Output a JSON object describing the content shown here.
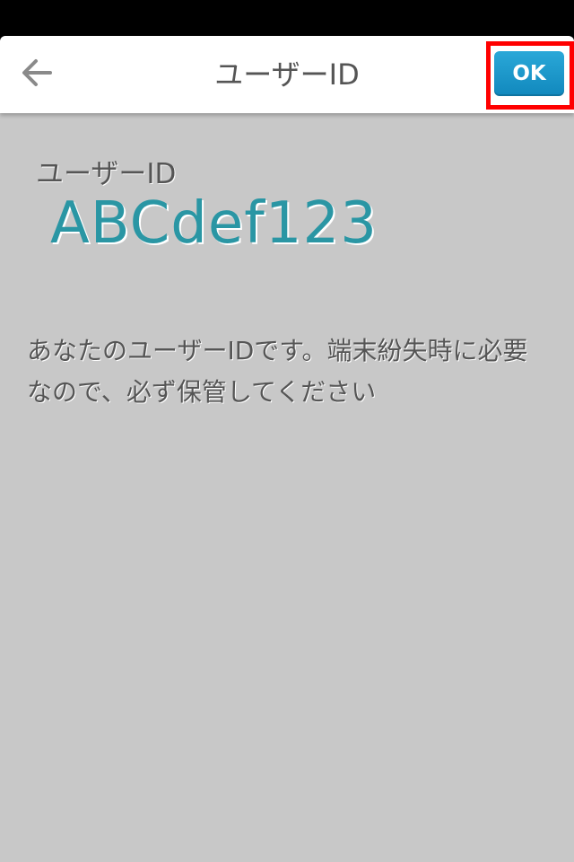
{
  "colors": {
    "background": "#c8c8c8",
    "nav_background": "#ffffff",
    "accent_teal": "#2a96a4",
    "ok_button_blue": "#1a98cc",
    "highlight_red": "#ff0000",
    "text_gray": "#555555"
  },
  "nav": {
    "back_icon": "arrow-left-icon",
    "title": "ユーザーID",
    "ok_label": "OK"
  },
  "content": {
    "field_label": "ユーザーID",
    "user_id": "ABCdef123",
    "description": "あなたのユーザーIDです。端末紛失時に必要なので、必ず保管してください"
  }
}
